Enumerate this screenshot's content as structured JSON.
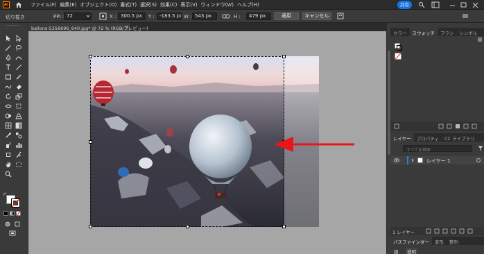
{
  "app": {
    "logo_text": "Ai"
  },
  "menu": {
    "items": [
      "ファイル(F)",
      "編集(E)",
      "オブジェクト(O)",
      "書式(T)",
      "選択(S)",
      "効果(C)",
      "表示(V)",
      "ウィンドウ(W)",
      "ヘルプ(H)"
    ],
    "share_label": "共有"
  },
  "control_bar": {
    "tool_name": "切り抜き",
    "ppi_label": "PPI :",
    "ppi_value": "72",
    "x_label": "X :",
    "x_value": "300.5 px",
    "y_label": "Y :",
    "y_value": "-183.5 px",
    "w_label": "W :",
    "w_value": "543 px",
    "h_label": "H :",
    "h_value": "479 px",
    "apply_label": "適用",
    "cancel_label": "キャンセル"
  },
  "document": {
    "tab_title": "ballons-5356696_640.jpg* @ 72 % (RGB/プレビュー)",
    "close_glyph": "×"
  },
  "panels": {
    "top_tabs": [
      "カラー",
      "スウォッチ",
      "ブラシ",
      "シンボル"
    ],
    "top_active": "スウォッチ",
    "layer_tabs": [
      "レイヤー",
      "プロパティ",
      "CC ライブラリ"
    ],
    "layer_active": "レイヤー",
    "search_placeholder": "すべてを検索",
    "layer_name": "レイヤー 1",
    "layer_count": "1 レイヤー",
    "bottom_tabs": [
      "パスファインダー",
      "変形",
      "整列"
    ],
    "bottom_active": "パスファインダー",
    "stroke_label": "線",
    "opacity_label": "透明"
  },
  "colors": {
    "accent": "#1473e6",
    "annotation_arrow": "#e8161b",
    "canvas_bg": "#a6a6a6"
  }
}
